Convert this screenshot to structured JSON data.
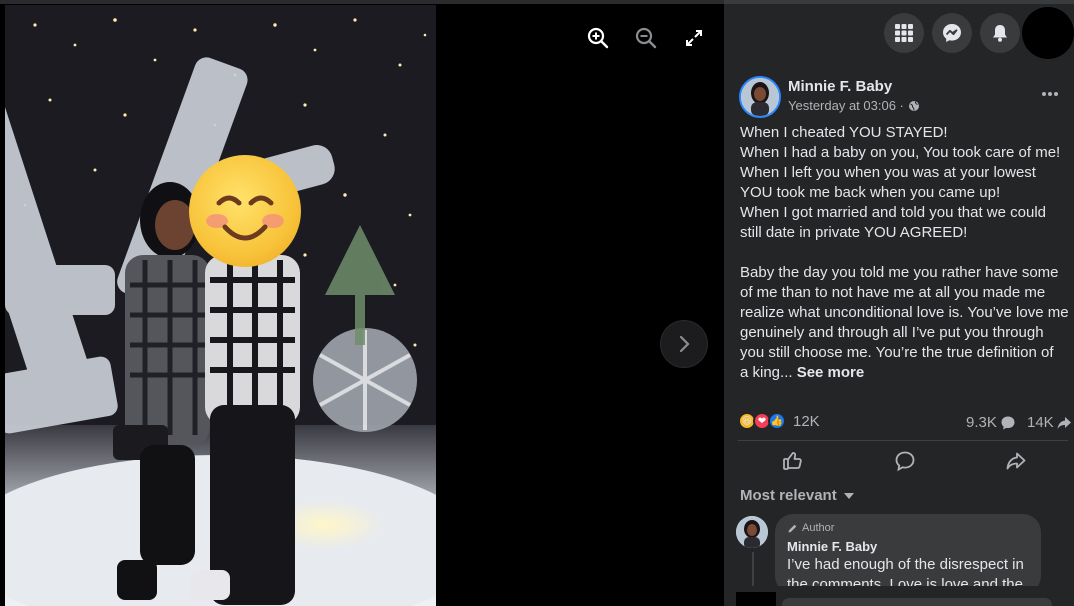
{
  "viewer": {
    "controls": {
      "zoom_in": "zoom-in-icon",
      "zoom_out": "zoom-out-icon",
      "fullscreen": "fullscreen-icon",
      "next": "chevron-right-icon"
    },
    "photo_overlay_emoji": "😊"
  },
  "topbar": {
    "icons": [
      "grid-menu-icon",
      "messenger-icon",
      "bell-icon",
      "account-avatar"
    ]
  },
  "post": {
    "author": "Minnie F. Baby",
    "timestamp": "Yesterday at 03:06 ·",
    "privacy_icon": "globe-icon",
    "lines": [
      "When I cheated YOU STAYED!",
      "When I had a baby on you, You took care of me!",
      "When I left you when you was at your lowest",
      "YOU took me back when you came up!",
      "When I got married and told you that we could",
      "still date in private YOU AGREED!",
      "",
      "Baby the day you told me you rather have some",
      "of me than to not have me at all you made me",
      "realize what unconditional love is. You’ve love me",
      "genuinely and through all I’ve put you through",
      "you still choose me. You’re the true definition of"
    ],
    "last_line": "a king...",
    "see_more": "See more",
    "reactions": {
      "types": [
        "😆",
        "❤",
        "👍"
      ],
      "count": "12K"
    },
    "comments_count": "9.3K",
    "shares_count": "14K"
  },
  "comments": {
    "sort_label": "Most relevant",
    "items": [
      {
        "badge": "Author",
        "name": "Minnie F. Baby",
        "text_lines": [
          "I’ve had enough of the disrespect in",
          "the comments. Love is love and the"
        ]
      }
    ]
  },
  "colors": {
    "panel_bg": "#242526",
    "text": "#e4e6eb",
    "muted": "#b0b3b8",
    "accent": "#2d88ff"
  }
}
